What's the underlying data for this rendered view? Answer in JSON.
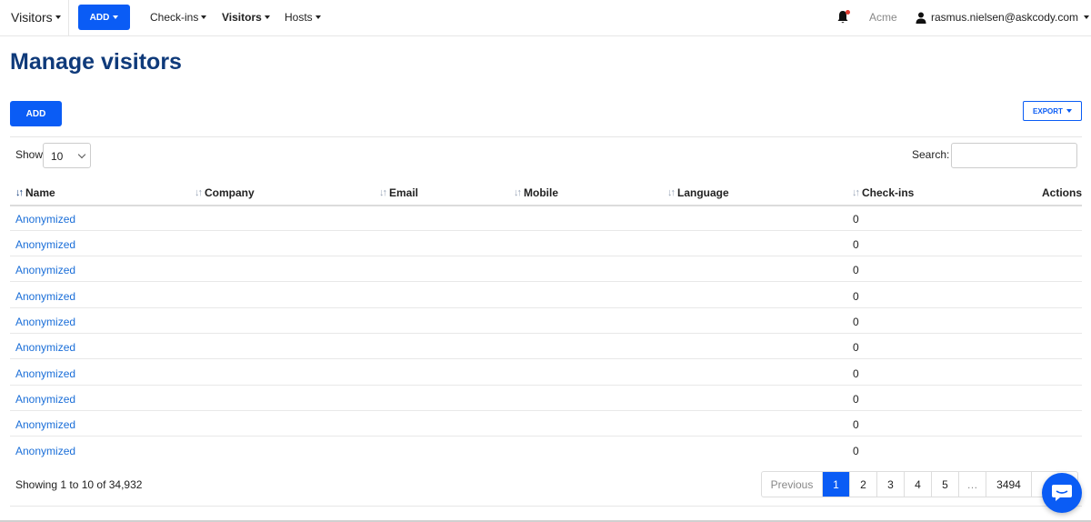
{
  "nav": {
    "app_menu": "Visitors",
    "add_label": "ADD",
    "links": [
      "Check-ins",
      "Visitors",
      "Hosts"
    ],
    "active_link": "Visitors",
    "org": "Acme",
    "user_email": "rasmus.nielsen@askcody.com"
  },
  "page": {
    "title": "Manage visitors",
    "add_label": "ADD",
    "export_label": "EXPORT"
  },
  "controls": {
    "show_label": "Show",
    "show_value": "10",
    "search_label": "Search:",
    "search_value": ""
  },
  "table": {
    "columns": [
      "Name",
      "Company",
      "Email",
      "Mobile",
      "Language",
      "Check-ins",
      "Actions"
    ],
    "sorted_column": "Name",
    "rows": [
      {
        "name": "Anonymized",
        "company": "",
        "email": "",
        "mobile": "",
        "language": "",
        "checkins": "0"
      },
      {
        "name": "Anonymized",
        "company": "",
        "email": "",
        "mobile": "",
        "language": "",
        "checkins": "0"
      },
      {
        "name": "Anonymized",
        "company": "",
        "email": "",
        "mobile": "",
        "language": "",
        "checkins": "0"
      },
      {
        "name": "Anonymized",
        "company": "",
        "email": "",
        "mobile": "",
        "language": "",
        "checkins": "0"
      },
      {
        "name": "Anonymized",
        "company": "",
        "email": "",
        "mobile": "",
        "language": "",
        "checkins": "0"
      },
      {
        "name": "Anonymized",
        "company": "",
        "email": "",
        "mobile": "",
        "language": "",
        "checkins": "0"
      },
      {
        "name": "Anonymized",
        "company": "",
        "email": "",
        "mobile": "",
        "language": "",
        "checkins": "0"
      },
      {
        "name": "Anonymized",
        "company": "",
        "email": "",
        "mobile": "",
        "language": "",
        "checkins": "0"
      },
      {
        "name": "Anonymized",
        "company": "",
        "email": "",
        "mobile": "",
        "language": "",
        "checkins": "0"
      },
      {
        "name": "Anonymized",
        "company": "",
        "email": "",
        "mobile": "",
        "language": "",
        "checkins": "0"
      }
    ]
  },
  "footer": {
    "info": "Showing 1 to 10 of 34,932",
    "pagination": {
      "previous": "Previous",
      "pages": [
        "1",
        "2",
        "3",
        "4",
        "5"
      ],
      "current": "1",
      "ellipsis": "…",
      "last": "3494"
    }
  },
  "colors": {
    "accent": "#0a5cf5",
    "title": "#0f3a7a",
    "link": "#1a6ed8"
  },
  "icons": {
    "bell": "bell-icon",
    "user": "user-icon",
    "sort": "sort-icon",
    "chat": "chat-icon"
  }
}
